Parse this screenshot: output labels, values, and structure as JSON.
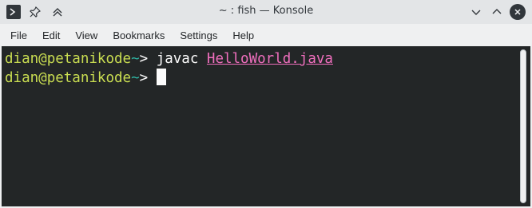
{
  "window": {
    "title": "~ : fish — Konsole"
  },
  "titlebar_buttons": {
    "app_icon": "terminal-icon",
    "pin": "pin-icon",
    "keep_above": "keep-above-icon",
    "minimize": "minimize-icon",
    "maximize": "maximize-icon",
    "close": "close-icon"
  },
  "menu": {
    "items": [
      "File",
      "Edit",
      "View",
      "Bookmarks",
      "Settings",
      "Help"
    ]
  },
  "terminal": {
    "lines": [
      {
        "user": "dian",
        "at": "@",
        "host": "petanikode",
        "cwd": "~",
        "prompt": "> ",
        "command": "javac ",
        "argument": "HelloWorld.java"
      },
      {
        "user": "dian",
        "at": "@",
        "host": "petanikode",
        "cwd": "~",
        "prompt": "> "
      }
    ]
  },
  "colors": {
    "terminal_background": "#232627",
    "prompt_user_host": "#c9dd51",
    "prompt_cwd": "#2fb5a4",
    "argument": "#f06fbe",
    "text": "#fcfcfc"
  }
}
